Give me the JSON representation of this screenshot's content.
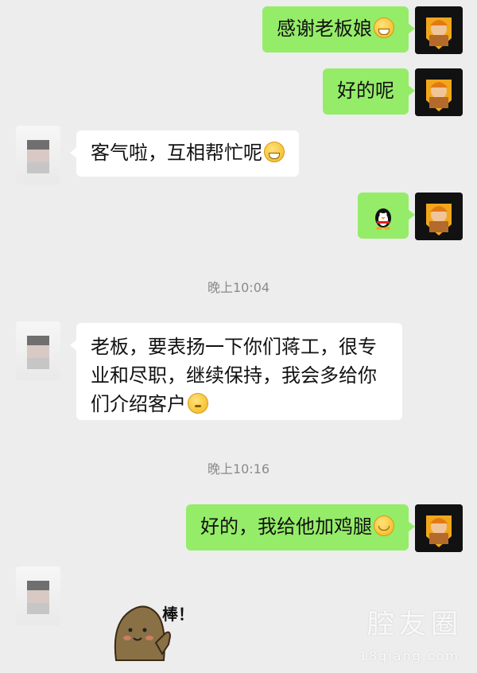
{
  "messages": [
    {
      "side": "right",
      "text": "感谢老板娘",
      "emoji": "grin-emoji"
    },
    {
      "side": "right",
      "text": "好的呢"
    },
    {
      "side": "left",
      "text": "客气啦，互相帮忙呢",
      "emoji": "grin-emoji"
    },
    {
      "side": "right",
      "sticker": "penguin-sticker"
    },
    {
      "side": "left",
      "lines": [
        "老板，要表扬一下你们蒋工，很专",
        "业和尽职，继续保持，我会多给你",
        "们介绍客户"
      ],
      "emoji": "thinking-emoji"
    },
    {
      "side": "right",
      "text": "好的，我给他加鸡腿",
      "emoji": "smile-emoji"
    },
    {
      "side": "left",
      "sticker": "bear-thumbs-up-sticker",
      "sticker_text": "棒！"
    }
  ],
  "timestamps": [
    "晚上10:04",
    "晚上10:16"
  ],
  "watermark": {
    "main": "腔友圈",
    "sub": "18qiang.com"
  },
  "colors": {
    "background": "#ededed",
    "bubble_self": "#95ec69",
    "bubble_other": "#ffffff",
    "timestamp": "#8a8a8a"
  }
}
